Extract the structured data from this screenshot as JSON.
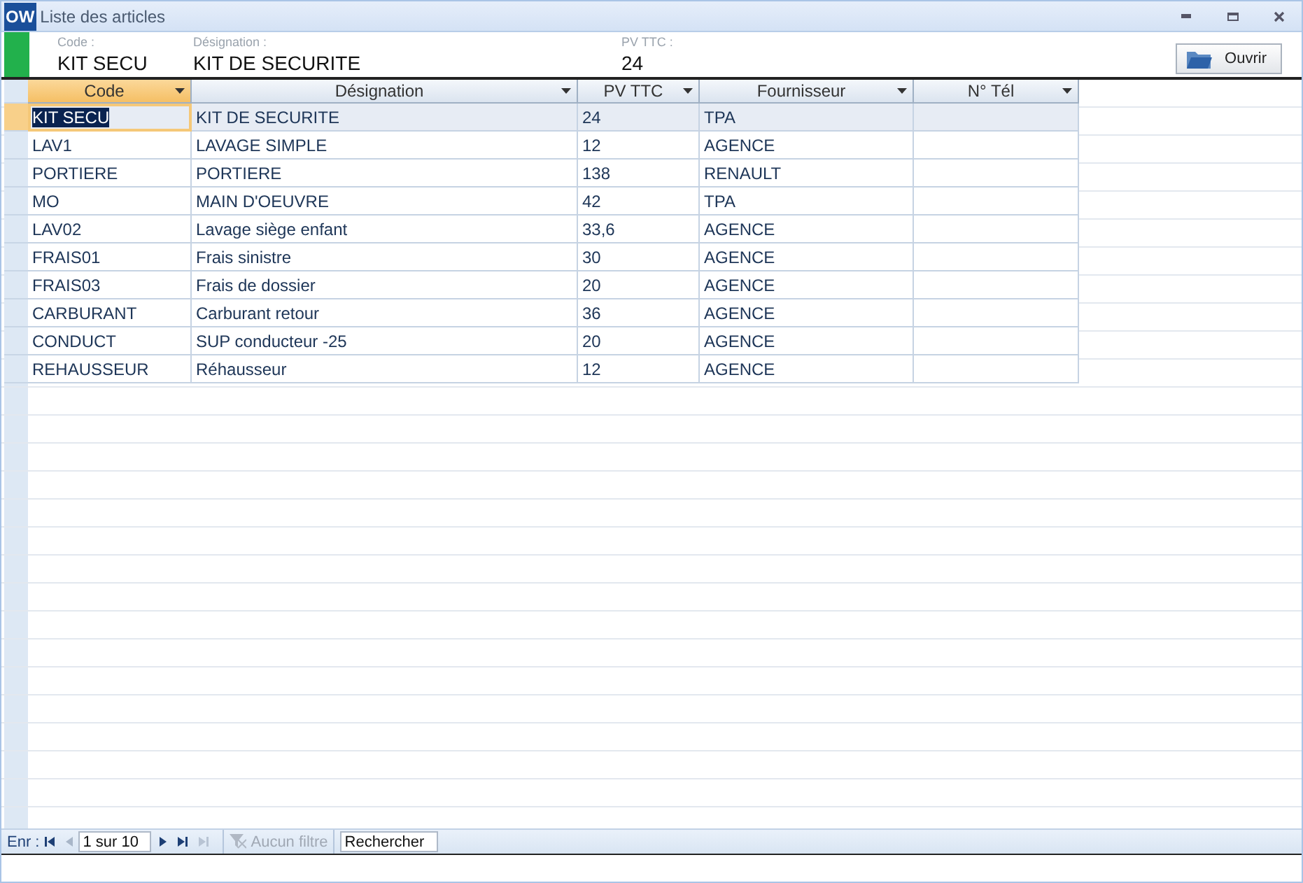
{
  "window": {
    "app_badge": "OW",
    "title": "Liste des articles"
  },
  "header": {
    "fields": [
      {
        "label": "Code :",
        "value": "KIT SECU"
      },
      {
        "label": "Désignation :",
        "value": "KIT DE SECURITE"
      },
      {
        "label": "PV TTC :",
        "value": "24"
      }
    ],
    "open_button": "Ouvrir"
  },
  "table": {
    "columns": [
      {
        "label": "Code",
        "selected": true
      },
      {
        "label": "Désignation",
        "selected": false
      },
      {
        "label": "PV TTC",
        "selected": false
      },
      {
        "label": "Fournisseur",
        "selected": false
      },
      {
        "label": "N° Tél",
        "selected": false
      }
    ],
    "rows": [
      {
        "cells": [
          "KIT SECU",
          "KIT DE SECURITE",
          "24",
          "TPA",
          ""
        ],
        "selected": true
      },
      {
        "cells": [
          "LAV1",
          "LAVAGE SIMPLE",
          "12",
          "AGENCE",
          ""
        ],
        "selected": false
      },
      {
        "cells": [
          "PORTIERE",
          "PORTIERE",
          "138",
          "RENAULT",
          ""
        ],
        "selected": false
      },
      {
        "cells": [
          "MO",
          "MAIN D'OEUVRE",
          "42",
          "TPA",
          ""
        ],
        "selected": false
      },
      {
        "cells": [
          "LAV02",
          "Lavage siège enfant",
          "33,6",
          "AGENCE",
          ""
        ],
        "selected": false
      },
      {
        "cells": [
          "FRAIS01",
          "Frais sinistre",
          "30",
          "AGENCE",
          ""
        ],
        "selected": false
      },
      {
        "cells": [
          "FRAIS03",
          "Frais de dossier",
          "20",
          "AGENCE",
          ""
        ],
        "selected": false
      },
      {
        "cells": [
          "CARBURANT",
          "Carburant retour",
          "36",
          "AGENCE",
          ""
        ],
        "selected": false
      },
      {
        "cells": [
          "CONDUCT",
          "SUP conducteur -25",
          "20",
          "AGENCE",
          ""
        ],
        "selected": false
      },
      {
        "cells": [
          "REHAUSSEUR",
          "Réhausseur",
          "12",
          "AGENCE",
          ""
        ],
        "selected": false
      }
    ]
  },
  "navigation": {
    "label": "Enr :",
    "position": "1 sur 10",
    "filter": {
      "label": "Aucun filtre",
      "disabled": true
    },
    "search_placeholder": "Rechercher"
  }
}
